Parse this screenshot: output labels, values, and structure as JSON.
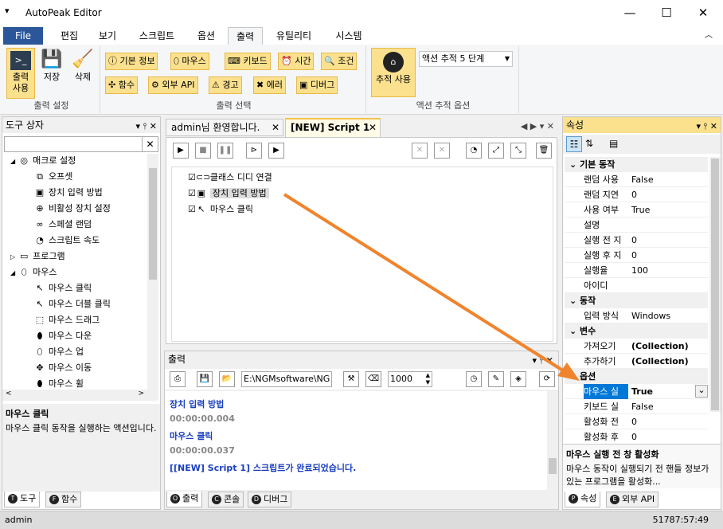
{
  "app": {
    "title": "AutoPeak Editor",
    "menu_icon": "▾"
  },
  "window": {
    "min": "—",
    "max": "☐",
    "close": "✕"
  },
  "tabs": [
    "File",
    "편집",
    "보기",
    "스크립트",
    "옵션",
    "출력",
    "유틸리티",
    "시스템"
  ],
  "ribbon": {
    "output_settings": {
      "label": "출력 설정",
      "btn_output": "출력\n사용",
      "btn_save": "저장",
      "btn_delete": "삭제"
    },
    "output_select": {
      "label": "출력 선택",
      "items": [
        "기본 정보",
        "마우스",
        "키보드",
        "시간",
        "조건",
        "함수",
        "외부 API",
        "경고",
        "에러",
        "디버그"
      ]
    },
    "trace": {
      "label": "액션 추적 옵션",
      "btn": "추적 사용",
      "combo": "액션 추적 5 단계"
    }
  },
  "toolbox": {
    "title": "도구 상자",
    "desc_title": "마우스 클릭",
    "desc_text": "마우스 클릭 동작을 실행하는 액션입니다.",
    "items": [
      {
        "label": "매크로 설정",
        "level": 1,
        "exp": "◢",
        "ic": "◎"
      },
      {
        "label": "오프셋",
        "level": 2,
        "ic": "⧉"
      },
      {
        "label": "장치 입력 방법",
        "level": 2,
        "ic": "▣"
      },
      {
        "label": "비활성 장치 설정",
        "level": 2,
        "ic": "⊕"
      },
      {
        "label": "스페셜 랜덤",
        "level": 2,
        "ic": "∞"
      },
      {
        "label": "스크립트 속도",
        "level": 2,
        "ic": "◔"
      },
      {
        "label": "프로그램",
        "level": 1,
        "exp": "▷",
        "ic": "▭"
      },
      {
        "label": "마우스",
        "level": 1,
        "exp": "◢",
        "ic": "⬯"
      },
      {
        "label": "마우스 클릭",
        "level": 2,
        "ic": "↖"
      },
      {
        "label": "마우스 더블 클릭",
        "level": 2,
        "ic": "↖"
      },
      {
        "label": "마우스 드래그",
        "level": 2,
        "ic": "⬚"
      },
      {
        "label": "마우스 다운",
        "level": 2,
        "ic": "⬮"
      },
      {
        "label": "마우스 업",
        "level": 2,
        "ic": "⬯"
      },
      {
        "label": "마우스 이동",
        "level": 2,
        "ic": "✥"
      },
      {
        "label": "마우스 휠",
        "level": 2,
        "ic": "⬮"
      }
    ],
    "tabs": [
      "도구",
      "함수"
    ]
  },
  "editor": {
    "tabs": [
      "admin님 환영합니다.",
      "[NEW] Script 1"
    ],
    "lines": [
      {
        "label": "클래스 디디 연결",
        "ic": "⊂⊃"
      },
      {
        "label": "장치 입력 방법",
        "ic": "▣"
      },
      {
        "label": "마우스 클릭",
        "ic": "↖"
      }
    ]
  },
  "output": {
    "title": "출력",
    "path": "E:\\NGMsoftware\\NG",
    "count": "1000",
    "lines": [
      {
        "text": "장치 입력 방법",
        "color": "#1a3fbf"
      },
      {
        "text": "00:00:00.004",
        "color": "#888"
      },
      {
        "text": "마우스 클릭",
        "color": "#1a3fbf"
      },
      {
        "text": "00:00:00.037",
        "color": "#888"
      },
      {
        "text": "[[NEW] Script 1] 스크립트가 완료되었습니다.",
        "color": "#1a3fbf"
      }
    ],
    "tabs": [
      "출력",
      "콘솔",
      "디버그"
    ]
  },
  "props": {
    "title": "속성",
    "rows": [
      {
        "cat": "기본 동작"
      },
      {
        "n": "랜덤 사용",
        "v": "False"
      },
      {
        "n": "랜덤 지연",
        "v": "0"
      },
      {
        "n": "사용 여부",
        "v": "True"
      },
      {
        "n": "설명",
        "v": ""
      },
      {
        "n": "실행 전 지",
        "v": "0"
      },
      {
        "n": "실행 후 지",
        "v": "0"
      },
      {
        "n": "실행율",
        "v": "100"
      },
      {
        "n": "아이디",
        "v": ""
      },
      {
        "cat": "동작"
      },
      {
        "n": "입력 방식",
        "v": "Windows"
      },
      {
        "cat": "변수"
      },
      {
        "n": "가져오기",
        "v": "(Collection)",
        "b": true
      },
      {
        "n": "추가하기",
        "v": "(Collection)",
        "b": true
      },
      {
        "cat": "옵션"
      },
      {
        "n": "마우스 실",
        "v": "True",
        "sel": true
      },
      {
        "n": "키보드 실",
        "v": "False"
      },
      {
        "n": "활성화 전",
        "v": "0"
      },
      {
        "n": "활성화 후",
        "v": "0"
      }
    ],
    "desc_title": "마우스 실행 전 창 활성화",
    "desc_text": "마우스 동작이 실행되기 전 핸들 정보가 있는 프로그램을 활성화...",
    "tabs": [
      "속성",
      "외부 API"
    ]
  },
  "status": {
    "user": "admin",
    "time": "51787:57:49"
  },
  "colors": {
    "accent": "#2b579a",
    "highlight": "#fbe18e",
    "arrow": "#f0842c"
  }
}
